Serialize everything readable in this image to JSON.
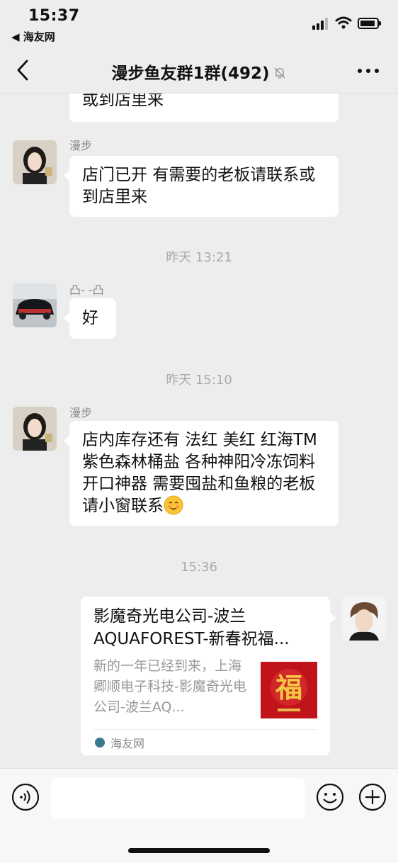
{
  "status_bar": {
    "time": "15:37",
    "back_app": "◀ 海友网"
  },
  "nav": {
    "title": "漫步鱼友群1群(492)"
  },
  "messages": [
    {
      "sender": "",
      "text": "或到店里来"
    },
    {
      "sender": "漫步",
      "text": "店门已开 有需要的老板请联系或到店里来"
    },
    {
      "timestamp": "昨天 13:21"
    },
    {
      "sender": "凸- -凸",
      "text": "好"
    },
    {
      "timestamp": "昨天 15:10"
    },
    {
      "sender": "漫步",
      "text": "店内库存还有 法红 美红 红海TM 紫色森林桶盐  各种神阳冷冻饲料开口神器 需要囤盐和鱼粮的老板请小窗联系"
    },
    {
      "timestamp": "15:36"
    }
  ],
  "link_card": {
    "title": "影魔奇光电公司-波兰AQUAFOREST-新春祝福...",
    "description": "新的一年已经到来，上海卿顺电子科技-影魔奇光电公司-波兰AQ...",
    "thumbnail_char": "福",
    "source": "海友网"
  },
  "input": {
    "placeholder": ""
  },
  "colors": {
    "background": "#ededed",
    "bubble": "#ffffff",
    "thumb_red": "#c0141a"
  }
}
